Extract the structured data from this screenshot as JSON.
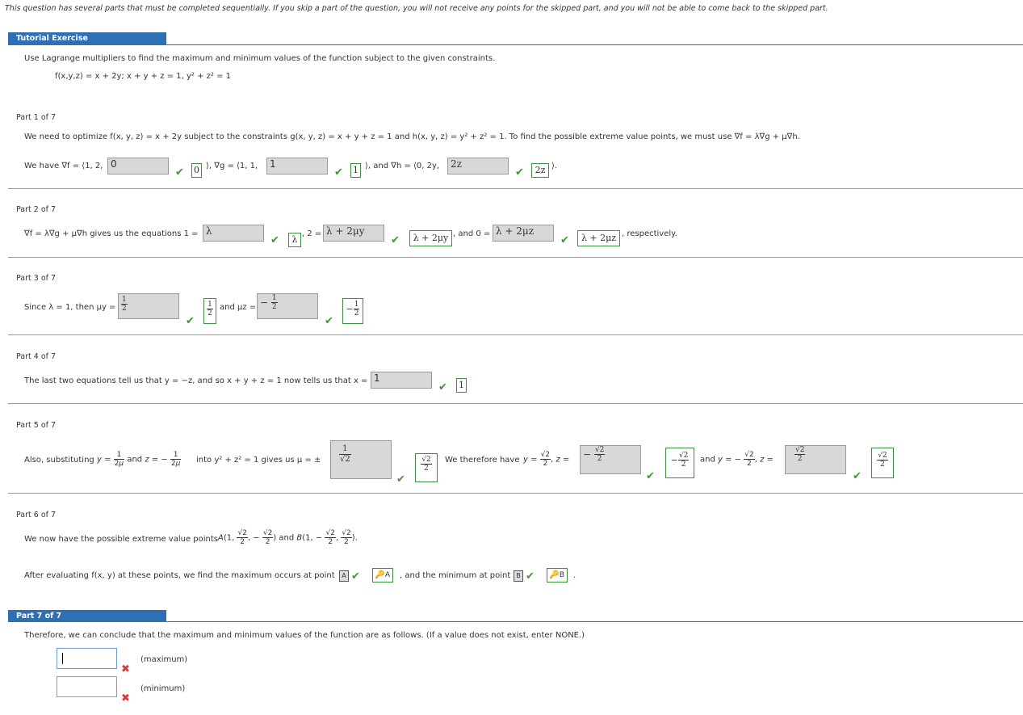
{
  "notice": "This question has several parts that must be completed sequentially. If you skip a part of the question, you will not receive any points for the skipped part, and you will not be able to come back to the skipped part.",
  "tutorial": {
    "tab_label": "Tutorial Exercise",
    "instruction": "Use Lagrange multipliers to find the maximum and minimum values of the function subject to the given constraints.",
    "function_line": "f(x,y,z) = x + 2y;   x + y + z = 1,   y² + z² = 1"
  },
  "part1": {
    "header": "Part 1 of 7",
    "text": "We need to optimize f(x, y, z) = x + 2y subject to the constraints g(x, y, z) = x + y + z = 1 and h(x, y, z) = y² + z² = 1. To find the possible extreme value points, we must use ∇f = λ∇g + μ∇h.",
    "we_have": "We have ∇f = ⟨1, 2,",
    "input1": "0",
    "answer1": "0",
    "grad_g": "⟩, ∇g = ⟨1, 1,",
    "input2": "1",
    "answer2": "1",
    "grad_h": "⟩, and ∇h = ⟨0, 2y,",
    "input3": "2z",
    "answer3": "2z",
    "close": "⟩."
  },
  "part2": {
    "header": "Part 2 of 7",
    "lead": "∇f = λ∇g + μ∇h gives us the equations 1 =",
    "input1": "λ",
    "answer1": "λ",
    "mid1": ", 2 =",
    "input2": "λ + 2μy",
    "answer2": "λ + 2μy",
    "mid2": ", and 0 =",
    "input3": "λ + 2μz",
    "answer3": "λ + 2μz",
    "tail": ", respectively."
  },
  "part3": {
    "header": "Part 3 of 7",
    "lead": "Since λ = 1, then μy =",
    "input1": "1/2",
    "answer1": "1/2",
    "mid": "and μz =",
    "input2": "−1/2",
    "answer2": "−1/2"
  },
  "part4": {
    "header": "Part 4 of 7",
    "text": "The last two equations tell us that y = −z, and so  x + y + z = 1  now tells us that x =",
    "input1": "1",
    "answer1": "1"
  },
  "part5": {
    "header": "Part 5 of 7",
    "lead": "Also, substituting",
    "text_into": "into  y² + z² = 1  gives us  μ = ±",
    "input1": "1/√2",
    "answer1": "√2/2",
    "we_therefore": "We therefore have",
    "input2": "√2/2",
    "answer2": "√2/2",
    "and_y": "and",
    "input3": "√2/2",
    "answer3": "√2/2"
  },
  "part6": {
    "header": "Part 6 of 7",
    "points_text": "We now have the possible extreme value points",
    "after_text": "After evaluating f(x, y) at these points, we find the maximum occurs at point",
    "max_point": "A",
    "max_answer": "A",
    "min_text": ", and the minimum at point",
    "min_point": "B",
    "min_answer": "B"
  },
  "part7": {
    "header": "Part 7 of 7",
    "text": "Therefore, we can conclude that the maximum and minimum values of the function are as follows. (If a value does not exist, enter NONE.)",
    "max_label": "(maximum)",
    "min_label": "(minimum)",
    "max_value": "",
    "min_value": ""
  },
  "colors": {
    "tab_blue": "#2f6fb5",
    "check_green": "#3a9a2a",
    "error_red": "#d9363e",
    "answer_border": "#3d8f3d"
  }
}
